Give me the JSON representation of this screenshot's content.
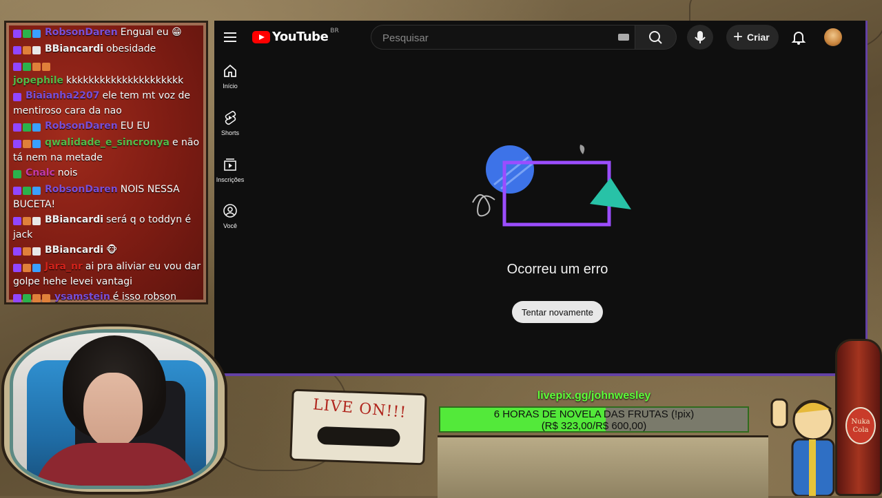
{
  "chat": {
    "messages": [
      {
        "user": "RobsonDaren",
        "user_color": "purple",
        "text": "Engual eu 😁",
        "badges": [
          "purple",
          "green",
          "blue"
        ]
      },
      {
        "user": "BBiancardi",
        "user_color": "white",
        "text": "obesidade",
        "badges": [
          "purple",
          "orange",
          "white"
        ]
      },
      {
        "user": "jopephile",
        "user_color": "green",
        "text": "kkkkkkkkkkkkkkkkkkkkk",
        "badges": [
          "purple",
          "green",
          "orange",
          "orange"
        ]
      },
      {
        "user": "Biaianha2207",
        "user_color": "purple",
        "text": "ele tem mt voz de mentiroso cara da nao",
        "badges": [
          "purple"
        ]
      },
      {
        "user": "RobsonDaren",
        "user_color": "purple",
        "text": "EU EU",
        "badges": [
          "purple",
          "green",
          "blue"
        ]
      },
      {
        "user": "qwalidade_e_sincronya",
        "user_color": "green",
        "text": "e não tá nem na metade",
        "badges": [
          "purple",
          "orange",
          "blue"
        ]
      },
      {
        "user": "Cnalc",
        "user_color": "pink",
        "text": "nois",
        "badges": [
          "green"
        ]
      },
      {
        "user": "RobsonDaren",
        "user_color": "purple",
        "text": "NOIS NESSA BUCETA!",
        "badges": [
          "purple",
          "green",
          "blue"
        ]
      },
      {
        "user": "BBiancardi",
        "user_color": "white",
        "text": "será q o toddyn é jack",
        "badges": [
          "purple",
          "orange",
          "white"
        ]
      },
      {
        "user": "BBiancardi",
        "user_color": "white",
        "text": "🐵",
        "badges": [
          "purple",
          "orange",
          "white"
        ]
      },
      {
        "user": "Jara_nr",
        "user_color": "red",
        "text": "ai pra aliviar eu vou dar golpe hehe levei vantagi",
        "badges": [
          "purple",
          "orange",
          "blue"
        ]
      },
      {
        "user": "ysamstein",
        "user_color": "purple",
        "text": "é isso robson",
        "badges": [
          "purple",
          "green",
          "orange",
          "orange"
        ]
      }
    ]
  },
  "youtube": {
    "logo_text": "YouTube",
    "country_code": "BR",
    "search_placeholder": "Pesquisar",
    "create_label": "Criar",
    "nav": [
      {
        "label": "Início",
        "icon": "home-icon"
      },
      {
        "label": "Shorts",
        "icon": "shorts-icon"
      },
      {
        "label": "Inscrições",
        "icon": "subscriptions-icon"
      },
      {
        "label": "Você",
        "icon": "you-icon"
      }
    ],
    "error_title": "Ocorreu um erro",
    "retry_label": "Tentar novamente"
  },
  "overlay": {
    "donation_link": "livepix.gg/johnwesley",
    "goal_title": "6 HORAS DE NOVELA DAS FRUTAS (!pix)",
    "goal_amount": "(R$ 323,00/R$ 600,00)",
    "goal_progress": 0.538,
    "cassette_label": "LIVE ON!!!",
    "bottle_label": "Nuka Cola"
  },
  "colors": {
    "accent_purple": "#6441a5",
    "progress_green": "#53e93a",
    "yt_red": "#ff0000"
  }
}
